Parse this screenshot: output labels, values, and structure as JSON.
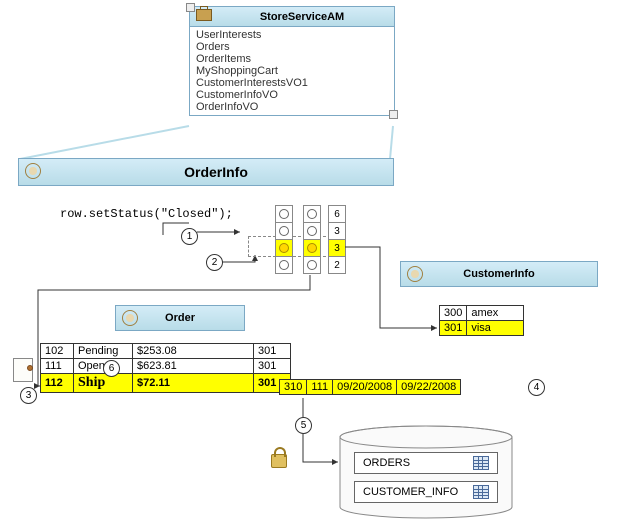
{
  "app_module": {
    "title": "StoreServiceAM",
    "items": [
      "UserInterests",
      "Orders",
      "OrderItems",
      "MyShoppingCart",
      "CustomerInterestsVO1",
      "CustomerInfoVO",
      "OrderInfoVO"
    ]
  },
  "order_info_panel": {
    "title": "OrderInfo"
  },
  "order_panel": {
    "title": "Order"
  },
  "customer_info_panel": {
    "title": "CustomerInfo"
  },
  "code_line": "row.setStatus(\"Closed\");",
  "order_table": {
    "rows": [
      {
        "c0": "102",
        "c1": "Pending",
        "c2": "$253.08",
        "c3": "301"
      },
      {
        "c0": "111",
        "c1": "Open",
        "c2": "$623.81",
        "c3": "301"
      },
      {
        "c0": "112",
        "c1": "Ship",
        "c2": "$72.11",
        "c3": "301"
      }
    ],
    "extra_row": {
      "c0": "310",
      "c1": "111",
      "c2": "09/20/2008",
      "c3": "09/22/2008"
    }
  },
  "customer_table": {
    "rows": [
      {
        "c0": "300",
        "c1": "amex"
      },
      {
        "c0": "301",
        "c1": "visa"
      }
    ]
  },
  "num_column": [
    "6",
    "3",
    "3",
    "2"
  ],
  "db": {
    "tables": [
      "ORDERS",
      "CUSTOMER_INFO"
    ]
  },
  "callouts": {
    "1": "1",
    "2": "2",
    "3": "3",
    "4": "4",
    "5": "5",
    "6": "6"
  }
}
